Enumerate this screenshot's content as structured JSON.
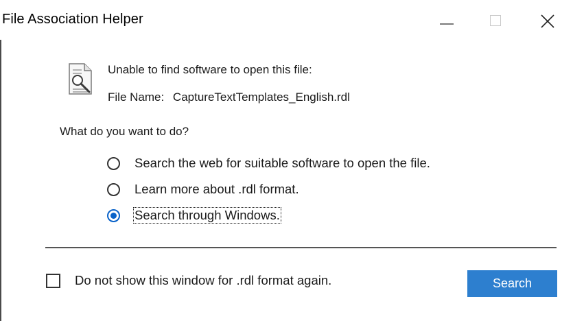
{
  "window": {
    "title": "File Association Helper"
  },
  "titlebar": {
    "minimize_icon": "minimize-icon",
    "maximize_icon": "maximize-icon",
    "close_icon": "close-icon"
  },
  "message": {
    "icon": "file-search-icon",
    "line1": "Unable to find software to open this file:",
    "file_name_label": "File Name:",
    "file_name_value": "CaptureTextTemplates_English.rdl"
  },
  "question": "What do you want to do?",
  "options": [
    {
      "label": "Search the web for suitable software to open the file.",
      "selected": false
    },
    {
      "label": "Learn more about .rdl format.",
      "selected": false
    },
    {
      "label": "Search through Windows.",
      "selected": true
    }
  ],
  "footer": {
    "checkbox_label": "Do not show this window for .rdl format again.",
    "checkbox_checked": false,
    "button_label": "Search",
    "button_color": "#2d7fcf"
  },
  "colors": {
    "accent": "#0a63c9"
  }
}
